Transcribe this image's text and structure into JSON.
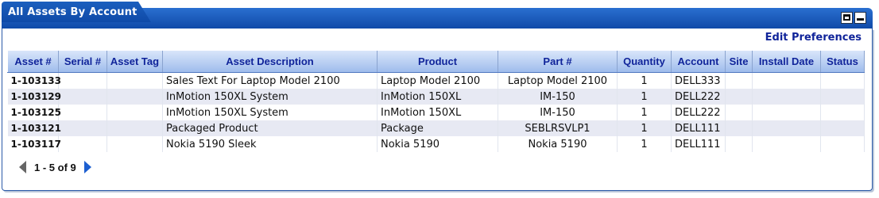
{
  "applet": {
    "title": "All Assets By Account",
    "edit_preferences": "Edit Preferences"
  },
  "table": {
    "columns": [
      "Asset #",
      "Serial #",
      "Asset Tag",
      "Asset Description",
      "Product",
      "Part #",
      "Quantity",
      "Account",
      "Site",
      "Install Date",
      "Status"
    ],
    "rows": [
      {
        "asset": "1-103133",
        "serial": "",
        "tag": "",
        "description": "Sales Text For Laptop Model 2100",
        "product": "Laptop Model 2100",
        "part": "Laptop Model 2100",
        "quantity": "1",
        "account": "DELL333",
        "site": "",
        "install_date": "",
        "status": ""
      },
      {
        "asset": "1-103129",
        "serial": "",
        "tag": "",
        "description": "InMotion 150XL System",
        "product": "InMotion 150XL",
        "part": "IM-150",
        "quantity": "1",
        "account": "DELL222",
        "site": "",
        "install_date": "",
        "status": ""
      },
      {
        "asset": "1-103125",
        "serial": "",
        "tag": "",
        "description": "InMotion 150XL System",
        "product": "InMotion 150XL",
        "part": "IM-150",
        "quantity": "1",
        "account": "DELL222",
        "site": "",
        "install_date": "",
        "status": ""
      },
      {
        "asset": "1-103121",
        "serial": "",
        "tag": "",
        "description": "Packaged Product",
        "product": "Package",
        "part": "SEBLRSVLP1",
        "quantity": "1",
        "account": "DELL111",
        "site": "",
        "install_date": "",
        "status": ""
      },
      {
        "asset": "1-103117",
        "serial": "",
        "tag": "",
        "description": "Nokia 5190 Sleek",
        "product": "Nokia 5190",
        "part": "Nokia 5190",
        "quantity": "1",
        "account": "DELL111",
        "site": "",
        "install_date": "",
        "status": ""
      }
    ]
  },
  "pager": {
    "text": "1 - 5 of 9",
    "prev_icon": "arrow-left-icon",
    "next_icon": "arrow-right-icon"
  },
  "colors": {
    "header_blue": "#0f4aa8",
    "link_blue": "#1030b0",
    "row_alt": "#e7e9f3"
  }
}
